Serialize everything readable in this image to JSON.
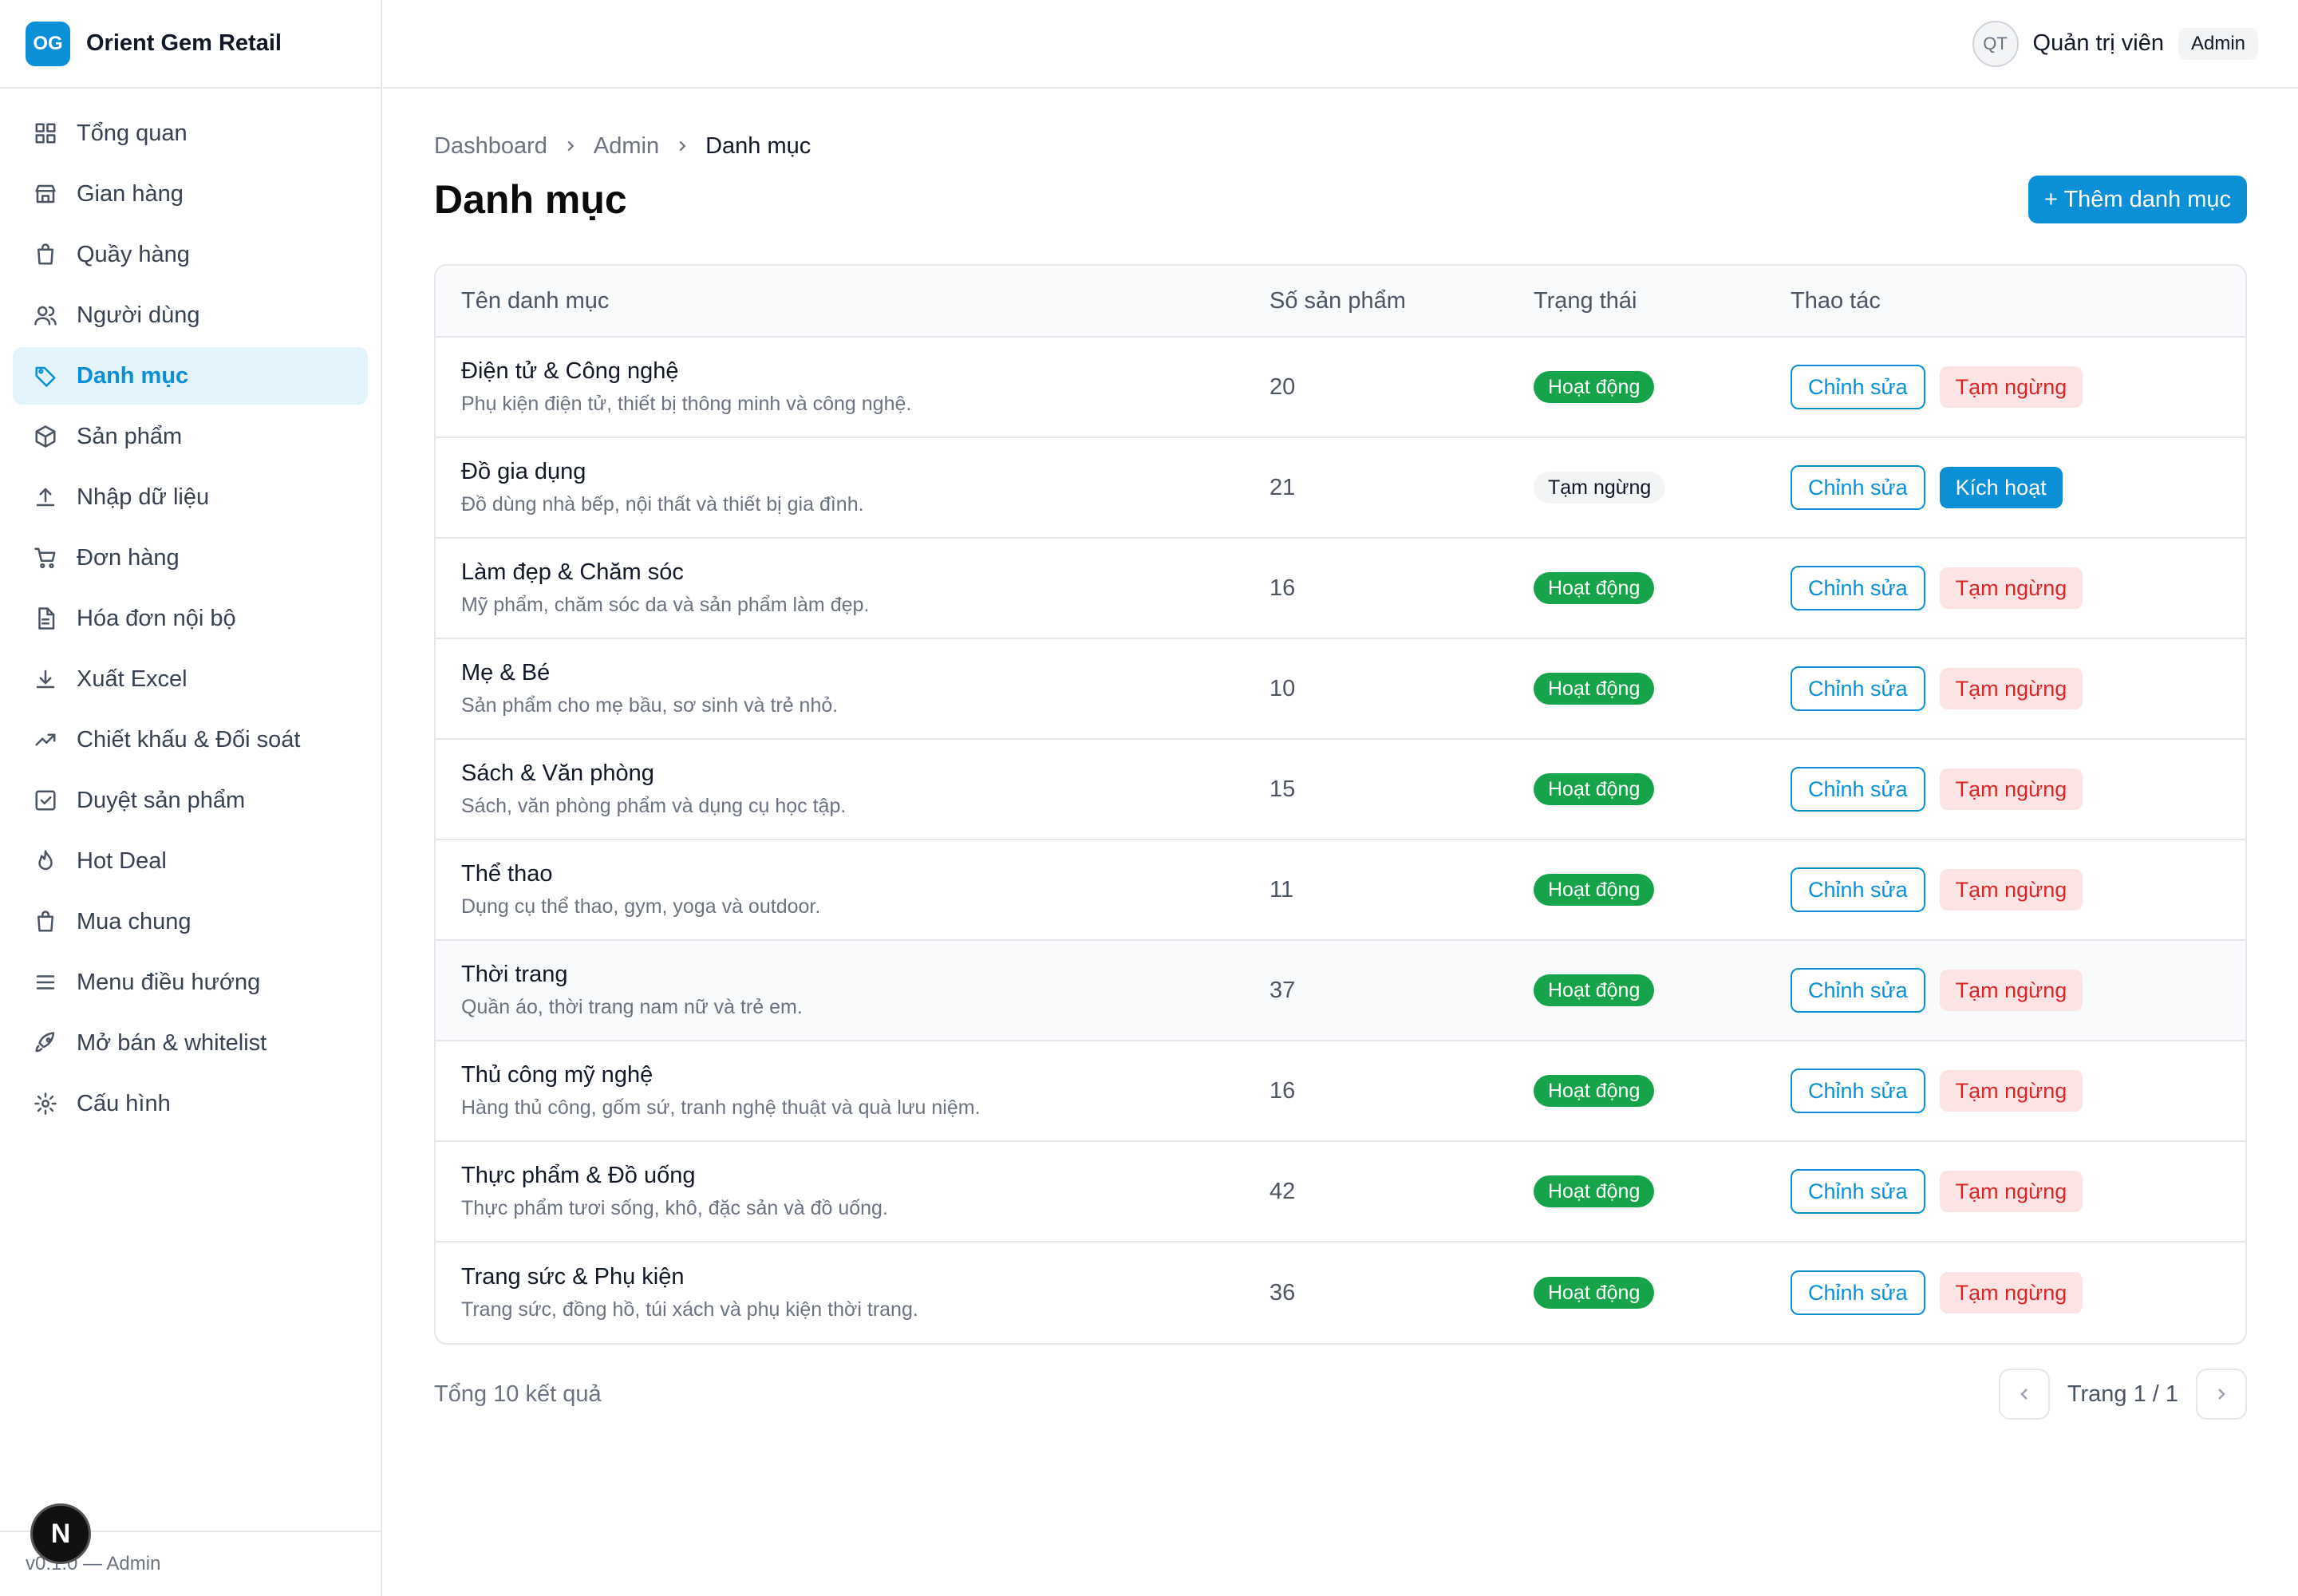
{
  "brand": {
    "logo": "OG",
    "name": "Orient Gem Retail"
  },
  "user": {
    "initials": "QT",
    "name": "Quản trị viên",
    "role": "Admin"
  },
  "sidebar": {
    "items": [
      {
        "label": "Tổng quan",
        "icon": "dashboard-icon"
      },
      {
        "label": "Gian hàng",
        "icon": "store-icon"
      },
      {
        "label": "Quầy hàng",
        "icon": "shopping-bag-icon"
      },
      {
        "label": "Người dùng",
        "icon": "users-icon"
      },
      {
        "label": "Danh mục",
        "icon": "tag-icon",
        "active": true
      },
      {
        "label": "Sản phẩm",
        "icon": "box-icon"
      },
      {
        "label": "Nhập dữ liệu",
        "icon": "upload-icon"
      },
      {
        "label": "Đơn hàng",
        "icon": "cart-icon"
      },
      {
        "label": "Hóa đơn nội bộ",
        "icon": "file-icon"
      },
      {
        "label": "Xuất Excel",
        "icon": "download-icon"
      },
      {
        "label": "Chiết khấu & Đối soát",
        "icon": "trending-up-icon"
      },
      {
        "label": "Duyệt sản phẩm",
        "icon": "check-square-icon"
      },
      {
        "label": "Hot Deal",
        "icon": "flame-icon"
      },
      {
        "label": "Mua chung",
        "icon": "shopping-bag-icon"
      },
      {
        "label": "Menu điều hướng",
        "icon": "menu-icon"
      },
      {
        "label": "Mở bán & whitelist",
        "icon": "rocket-icon"
      },
      {
        "label": "Cấu hình",
        "icon": "settings-icon"
      }
    ],
    "footer": "v0.1.0 — Admin"
  },
  "breadcrumb": [
    "Dashboard",
    "Admin",
    "Danh mục"
  ],
  "page": {
    "title": "Danh mục",
    "add_label": "+ Thêm danh mục"
  },
  "table": {
    "headers": [
      "Tên danh mục",
      "Số sản phẩm",
      "Trạng thái",
      "Thao tác"
    ],
    "edit_label": "Chỉnh sửa",
    "pause_label": "Tạm ngừng",
    "activate_label": "Kích hoạt",
    "rows": [
      {
        "name": "Điện tử & Công nghệ",
        "desc": "Phụ kiện điện tử, thiết bị thông minh và công nghệ.",
        "count": "20",
        "status": "Hoạt động",
        "active": true
      },
      {
        "name": "Đồ gia dụng",
        "desc": "Đồ dùng nhà bếp, nội thất và thiết bị gia đình.",
        "count": "21",
        "status": "Tạm ngừng",
        "active": false
      },
      {
        "name": "Làm đẹp & Chăm sóc",
        "desc": "Mỹ phẩm, chăm sóc da và sản phẩm làm đẹp.",
        "count": "16",
        "status": "Hoạt động",
        "active": true
      },
      {
        "name": "Mẹ & Bé",
        "desc": "Sản phẩm cho mẹ bầu, sơ sinh và trẻ nhỏ.",
        "count": "10",
        "status": "Hoạt động",
        "active": true
      },
      {
        "name": "Sách & Văn phòng",
        "desc": "Sách, văn phòng phẩm và dụng cụ học tập.",
        "count": "15",
        "status": "Hoạt động",
        "active": true
      },
      {
        "name": "Thể thao",
        "desc": "Dụng cụ thể thao, gym, yoga và outdoor.",
        "count": "11",
        "status": "Hoạt động",
        "active": true
      },
      {
        "name": "Thời trang",
        "desc": "Quần áo, thời trang nam nữ và trẻ em.",
        "count": "37",
        "status": "Hoạt động",
        "active": true
      },
      {
        "name": "Thủ công mỹ nghệ",
        "desc": "Hàng thủ công, gốm sứ, tranh nghệ thuật và quà lưu niệm.",
        "count": "16",
        "status": "Hoạt động",
        "active": true
      },
      {
        "name": "Thực phẩm & Đồ uống",
        "desc": "Thực phẩm tươi sống, khô, đặc sản và đồ uống.",
        "count": "42",
        "status": "Hoạt động",
        "active": true
      },
      {
        "name": "Trang sức & Phụ kiện",
        "desc": "Trang sức, đồng hồ, túi xách và phụ kiện thời trang.",
        "count": "36",
        "status": "Hoạt động",
        "active": true
      }
    ]
  },
  "pagination": {
    "total": "Tổng 10 kết quả",
    "page_label": "Trang 1 / 1"
  },
  "colors": {
    "accent": "#0b8fd6",
    "success": "#16a34a",
    "danger": "#dc2626"
  }
}
